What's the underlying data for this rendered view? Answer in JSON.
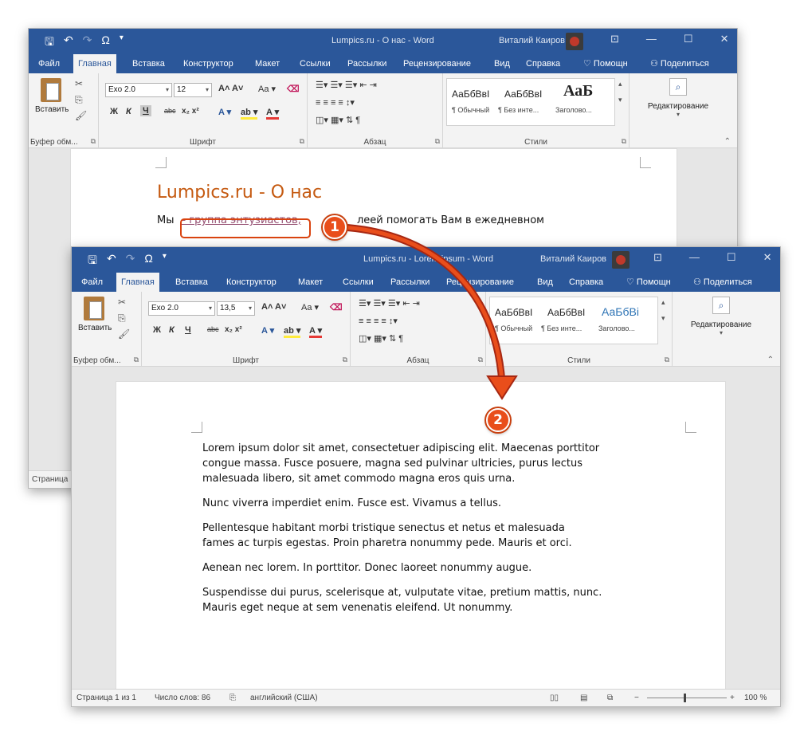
{
  "colors": {
    "ribbon_blue": "#2b579a",
    "heading_orange": "#c55a11",
    "callout": "#e94e1b",
    "link": "#954f72"
  },
  "back_window": {
    "title": "Lumpics.ru - О нас  -  Word",
    "user": "Виталий Каиров",
    "tabs": [
      "Файл",
      "Главная",
      "Вставка",
      "Конструктор",
      "Макет",
      "Ссылки",
      "Рассылки",
      "Рецензирование",
      "Вид",
      "Справка",
      "Помощн",
      "Поделиться"
    ],
    "font_name": "Exo 2.0",
    "font_size": "12",
    "styles": [
      {
        "preview": "АаБбВвI",
        "name": "¶ Обычный"
      },
      {
        "preview": "АаБбВвI",
        "name": "¶ Без инте..."
      },
      {
        "preview": "АаБ",
        "name": "Заголово..."
      }
    ],
    "heading": "Lumpics.ru - О нас",
    "line_start": "Мы",
    "link_text": "– группа энтузиастов,",
    "line_rest": "леей помогать Вам в ежедневном",
    "status_left": "Страница"
  },
  "front_window": {
    "title": "Lumpics.ru - Lorem ipsum  -  Word",
    "user": "Виталий Каиров",
    "tabs": [
      "Файл",
      "Главная",
      "Вставка",
      "Конструктор",
      "Макет",
      "Ссылки",
      "Рассылки",
      "Рецензирование",
      "Вид",
      "Справка",
      "Помощн",
      "Поделиться"
    ],
    "font_name": "Exo 2.0",
    "font_size": "13,5",
    "styles": [
      {
        "preview": "АаБбВвI",
        "name": "¶ Обычный"
      },
      {
        "preview": "АаБбВвI",
        "name": "¶ Без инте..."
      },
      {
        "preview": "АаБбВі",
        "name": "Заголово..."
      }
    ],
    "paragraphs": [
      [
        "Lorem ipsum dolor sit amet, consectetuer adipiscing elit. Maecenas porttitor",
        "congue massa. Fusce posuere, magna sed pulvinar ultricies, purus lectus",
        "malesuada libero, sit amet commodo magna eros quis urna."
      ],
      [
        "Nunc viverra imperdiet enim. Fusce est. Vivamus a tellus."
      ],
      [
        "Pellentesque habitant morbi tristique senectus et netus et malesuada",
        "fames ac turpis egestas. Proin pharetra nonummy pede. Mauris et orci."
      ],
      [
        "Aenean nec lorem. In porttitor. Donec laoreet nonummy augue."
      ],
      [
        "Suspendisse dui purus, scelerisque at, vulputate vitae, pretium mattis, nunc.",
        "Mauris eget neque at sem venenatis eleifend. Ut nonummy."
      ]
    ],
    "status": {
      "page": "Страница 1 из 1",
      "words": "Число слов: 86",
      "lang": "английский (США)",
      "zoom": "100 %"
    }
  },
  "ribbon_labels": {
    "paste": "Вставить",
    "clipboard": "Буфер обм...",
    "font": "Шрифт",
    "paragraph": "Абзац",
    "styles": "Стили",
    "editing": "Редактирование"
  },
  "callouts": {
    "one": "1",
    "two": "2"
  }
}
